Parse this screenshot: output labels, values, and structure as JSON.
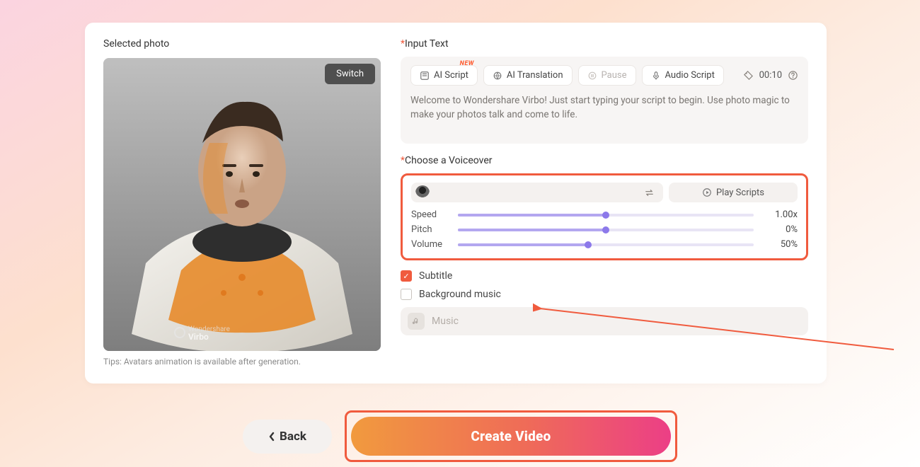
{
  "left": {
    "title": "Selected photo",
    "switch": "Switch",
    "tip": "Tips: Avatars animation is available after generation.",
    "watermark_brand": "Wondershare",
    "watermark_product": "Virbo"
  },
  "input": {
    "label": "Input Text",
    "chips": {
      "ai_script": "AI Script",
      "ai_script_badge": "NEW",
      "ai_translation": "AI Translation",
      "pause": "Pause",
      "audio_script": "Audio Script"
    },
    "duration": "00:10",
    "script": "Welcome to Wondershare Virbo! Just start typing your script to begin. Use photo magic to make your photos talk and come to life."
  },
  "voice": {
    "label": "Choose a Voiceover",
    "play": "Play Scripts",
    "sliders": {
      "speed": {
        "label": "Speed",
        "value": "1.00x",
        "percent": 50
      },
      "pitch": {
        "label": "Pitch",
        "value": "0%",
        "percent": 50
      },
      "volume": {
        "label": "Volume",
        "value": "50%",
        "percent": 44
      }
    }
  },
  "options": {
    "subtitle": {
      "label": "Subtitle",
      "checked": true
    },
    "bgm": {
      "label": "Background music",
      "checked": false
    },
    "music_placeholder": "Music"
  },
  "footer": {
    "back": "Back",
    "create": "Create Video"
  }
}
